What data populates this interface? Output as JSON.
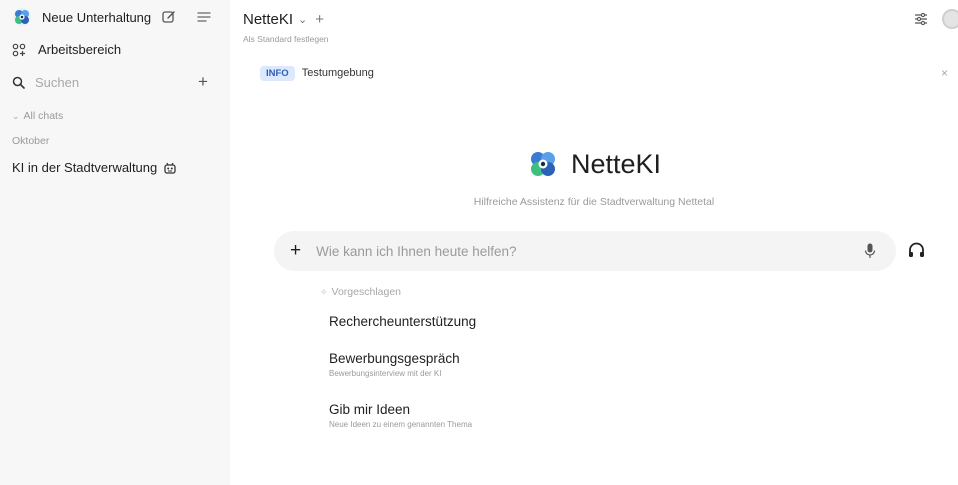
{
  "sidebar": {
    "new_chat_label": "Neue Unterhaltung",
    "workspace_label": "Arbeitsbereich",
    "search": {
      "placeholder": "Suchen"
    },
    "all_chats_label": "All chats",
    "month_label": "Oktober",
    "chats": [
      {
        "title": "KI in der Stadtverwaltung"
      }
    ]
  },
  "header": {
    "model_name": "NetteKI",
    "set_default_label": "Als Standard festlegen"
  },
  "banner": {
    "badge": "INFO",
    "text": "Testumgebung",
    "close_glyph": "×"
  },
  "hero": {
    "title": "NetteKI",
    "subtitle": "Hilfreiche Assistenz für die Stadtverwaltung Nettetal"
  },
  "prompt": {
    "placeholder": "Wie kann ich Ihnen heute helfen?"
  },
  "suggestions": {
    "heading": "Vorgeschlagen",
    "items": [
      {
        "title": "Rechercheunterstützung",
        "subtitle": ""
      },
      {
        "title": "Bewerbungsgespräch",
        "subtitle": "Bewerbungsinterview mit der KI"
      },
      {
        "title": "Gib mir Ideen",
        "subtitle": "Neue Ideen zu einem genannten Thema"
      }
    ]
  },
  "colors": {
    "sidebar_bg": "#f7f7f7",
    "badge_bg": "#dce8fb",
    "badge_text": "#2f5fb8",
    "logo_blue": "#3a7bd5",
    "logo_green": "#3fbf7f"
  },
  "icons": [
    "logo-icon",
    "edit-icon",
    "menu-icon",
    "workspace-icon",
    "search-icon",
    "plus-icon",
    "chevron-down-icon",
    "robot-icon",
    "controls-icon",
    "avatar",
    "close-icon",
    "mic-icon",
    "headphones-icon",
    "sparkle-icon"
  ]
}
